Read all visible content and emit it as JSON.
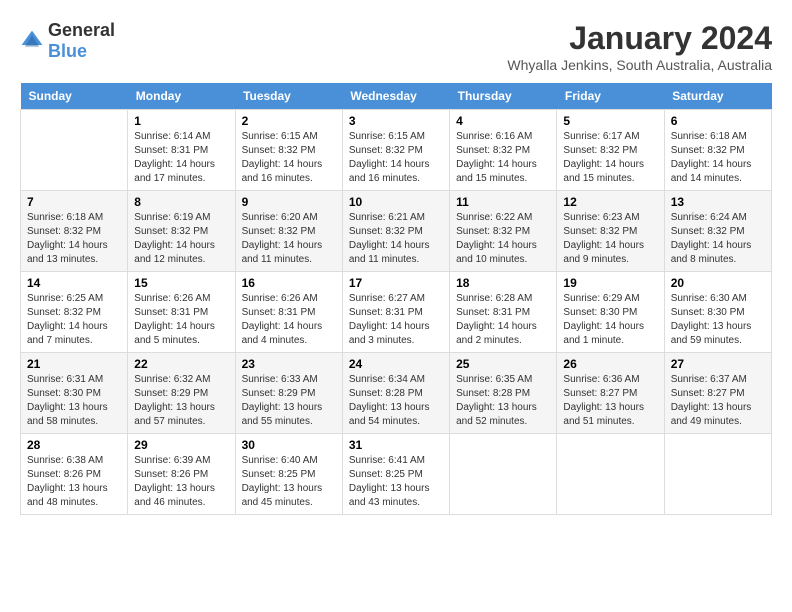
{
  "header": {
    "logo_general": "General",
    "logo_blue": "Blue",
    "title": "January 2024",
    "subtitle": "Whyalla Jenkins, South Australia, Australia"
  },
  "calendar": {
    "days_of_week": [
      "Sunday",
      "Monday",
      "Tuesday",
      "Wednesday",
      "Thursday",
      "Friday",
      "Saturday"
    ],
    "weeks": [
      [
        {
          "day": "",
          "sunrise": "",
          "sunset": "",
          "daylight": "",
          "empty": true
        },
        {
          "day": "1",
          "sunrise": "Sunrise: 6:14 AM",
          "sunset": "Sunset: 8:31 PM",
          "daylight": "Daylight: 14 hours and 17 minutes."
        },
        {
          "day": "2",
          "sunrise": "Sunrise: 6:15 AM",
          "sunset": "Sunset: 8:32 PM",
          "daylight": "Daylight: 14 hours and 16 minutes."
        },
        {
          "day": "3",
          "sunrise": "Sunrise: 6:15 AM",
          "sunset": "Sunset: 8:32 PM",
          "daylight": "Daylight: 14 hours and 16 minutes."
        },
        {
          "day": "4",
          "sunrise": "Sunrise: 6:16 AM",
          "sunset": "Sunset: 8:32 PM",
          "daylight": "Daylight: 14 hours and 15 minutes."
        },
        {
          "day": "5",
          "sunrise": "Sunrise: 6:17 AM",
          "sunset": "Sunset: 8:32 PM",
          "daylight": "Daylight: 14 hours and 15 minutes."
        },
        {
          "day": "6",
          "sunrise": "Sunrise: 6:18 AM",
          "sunset": "Sunset: 8:32 PM",
          "daylight": "Daylight: 14 hours and 14 minutes."
        }
      ],
      [
        {
          "day": "7",
          "sunrise": "Sunrise: 6:18 AM",
          "sunset": "Sunset: 8:32 PM",
          "daylight": "Daylight: 14 hours and 13 minutes."
        },
        {
          "day": "8",
          "sunrise": "Sunrise: 6:19 AM",
          "sunset": "Sunset: 8:32 PM",
          "daylight": "Daylight: 14 hours and 12 minutes."
        },
        {
          "day": "9",
          "sunrise": "Sunrise: 6:20 AM",
          "sunset": "Sunset: 8:32 PM",
          "daylight": "Daylight: 14 hours and 11 minutes."
        },
        {
          "day": "10",
          "sunrise": "Sunrise: 6:21 AM",
          "sunset": "Sunset: 8:32 PM",
          "daylight": "Daylight: 14 hours and 11 minutes."
        },
        {
          "day": "11",
          "sunrise": "Sunrise: 6:22 AM",
          "sunset": "Sunset: 8:32 PM",
          "daylight": "Daylight: 14 hours and 10 minutes."
        },
        {
          "day": "12",
          "sunrise": "Sunrise: 6:23 AM",
          "sunset": "Sunset: 8:32 PM",
          "daylight": "Daylight: 14 hours and 9 minutes."
        },
        {
          "day": "13",
          "sunrise": "Sunrise: 6:24 AM",
          "sunset": "Sunset: 8:32 PM",
          "daylight": "Daylight: 14 hours and 8 minutes."
        }
      ],
      [
        {
          "day": "14",
          "sunrise": "Sunrise: 6:25 AM",
          "sunset": "Sunset: 8:32 PM",
          "daylight": "Daylight: 14 hours and 7 minutes."
        },
        {
          "day": "15",
          "sunrise": "Sunrise: 6:26 AM",
          "sunset": "Sunset: 8:31 PM",
          "daylight": "Daylight: 14 hours and 5 minutes."
        },
        {
          "day": "16",
          "sunrise": "Sunrise: 6:26 AM",
          "sunset": "Sunset: 8:31 PM",
          "daylight": "Daylight: 14 hours and 4 minutes."
        },
        {
          "day": "17",
          "sunrise": "Sunrise: 6:27 AM",
          "sunset": "Sunset: 8:31 PM",
          "daylight": "Daylight: 14 hours and 3 minutes."
        },
        {
          "day": "18",
          "sunrise": "Sunrise: 6:28 AM",
          "sunset": "Sunset: 8:31 PM",
          "daylight": "Daylight: 14 hours and 2 minutes."
        },
        {
          "day": "19",
          "sunrise": "Sunrise: 6:29 AM",
          "sunset": "Sunset: 8:30 PM",
          "daylight": "Daylight: 14 hours and 1 minute."
        },
        {
          "day": "20",
          "sunrise": "Sunrise: 6:30 AM",
          "sunset": "Sunset: 8:30 PM",
          "daylight": "Daylight: 13 hours and 59 minutes."
        }
      ],
      [
        {
          "day": "21",
          "sunrise": "Sunrise: 6:31 AM",
          "sunset": "Sunset: 8:30 PM",
          "daylight": "Daylight: 13 hours and 58 minutes."
        },
        {
          "day": "22",
          "sunrise": "Sunrise: 6:32 AM",
          "sunset": "Sunset: 8:29 PM",
          "daylight": "Daylight: 13 hours and 57 minutes."
        },
        {
          "day": "23",
          "sunrise": "Sunrise: 6:33 AM",
          "sunset": "Sunset: 8:29 PM",
          "daylight": "Daylight: 13 hours and 55 minutes."
        },
        {
          "day": "24",
          "sunrise": "Sunrise: 6:34 AM",
          "sunset": "Sunset: 8:28 PM",
          "daylight": "Daylight: 13 hours and 54 minutes."
        },
        {
          "day": "25",
          "sunrise": "Sunrise: 6:35 AM",
          "sunset": "Sunset: 8:28 PM",
          "daylight": "Daylight: 13 hours and 52 minutes."
        },
        {
          "day": "26",
          "sunrise": "Sunrise: 6:36 AM",
          "sunset": "Sunset: 8:27 PM",
          "daylight": "Daylight: 13 hours and 51 minutes."
        },
        {
          "day": "27",
          "sunrise": "Sunrise: 6:37 AM",
          "sunset": "Sunset: 8:27 PM",
          "daylight": "Daylight: 13 hours and 49 minutes."
        }
      ],
      [
        {
          "day": "28",
          "sunrise": "Sunrise: 6:38 AM",
          "sunset": "Sunset: 8:26 PM",
          "daylight": "Daylight: 13 hours and 48 minutes."
        },
        {
          "day": "29",
          "sunrise": "Sunrise: 6:39 AM",
          "sunset": "Sunset: 8:26 PM",
          "daylight": "Daylight: 13 hours and 46 minutes."
        },
        {
          "day": "30",
          "sunrise": "Sunrise: 6:40 AM",
          "sunset": "Sunset: 8:25 PM",
          "daylight": "Daylight: 13 hours and 45 minutes."
        },
        {
          "day": "31",
          "sunrise": "Sunrise: 6:41 AM",
          "sunset": "Sunset: 8:25 PM",
          "daylight": "Daylight: 13 hours and 43 minutes."
        },
        {
          "day": "",
          "sunrise": "",
          "sunset": "",
          "daylight": "",
          "empty": true
        },
        {
          "day": "",
          "sunrise": "",
          "sunset": "",
          "daylight": "",
          "empty": true
        },
        {
          "day": "",
          "sunrise": "",
          "sunset": "",
          "daylight": "",
          "empty": true
        }
      ]
    ]
  }
}
